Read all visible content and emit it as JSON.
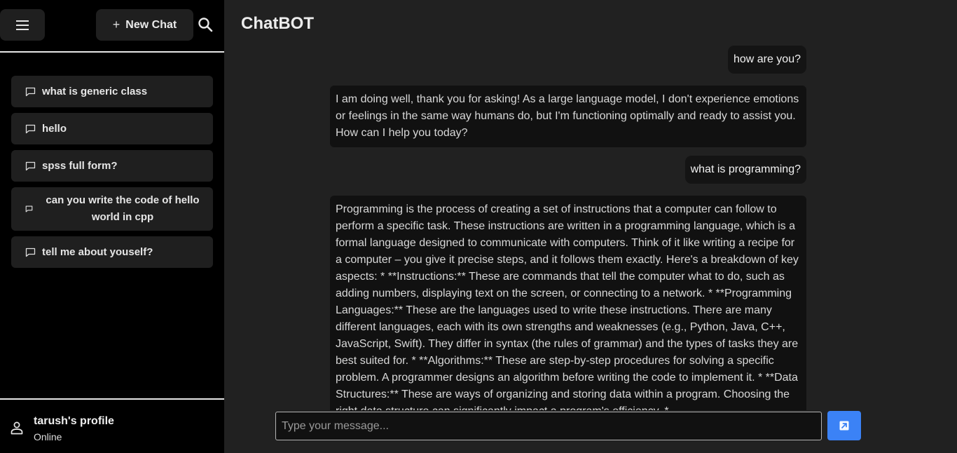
{
  "sidebar": {
    "new_chat_label": "New Chat",
    "history": [
      {
        "label": "what is generic class"
      },
      {
        "label": "hello"
      },
      {
        "label": "spss full form?"
      },
      {
        "label": "can you write the code of hello world in cpp"
      },
      {
        "label": "tell me about youself?"
      }
    ],
    "profile": {
      "name": "tarush's profile",
      "status": "Online"
    }
  },
  "main": {
    "title": "ChatBOT",
    "messages": [
      {
        "role": "user",
        "text": "how are you?"
      },
      {
        "role": "bot",
        "text": "I am doing well, thank you for asking! As a large language model, I don't experience emotions or feelings in the same way humans do, but I'm functioning optimally and ready to assist you. How can I help you today?"
      },
      {
        "role": "user",
        "text": "what is programming?"
      },
      {
        "role": "bot",
        "text": "Programming is the process of creating a set of instructions that a computer can follow to perform a specific task. These instructions are written in a programming language, which is a formal language designed to communicate with computers. Think of it like writing a recipe for a computer – you give it precise steps, and it follows them exactly. Here's a breakdown of key aspects: * **Instructions:** These are commands that tell the computer what to do, such as adding numbers, displaying text on the screen, or connecting to a network. * **Programming Languages:** These are the languages used to write these instructions. There are many different languages, each with its own strengths and weaknesses (e.g., Python, Java, C++, JavaScript, Swift). They differ in syntax (the rules of grammar) and the types of tasks they are best suited for. * **Algorithms:** These are step-by-step procedures for solving a specific problem. A programmer designs an algorithm before writing the code to implement it. * **Data Structures:** These are ways of organizing and storing data within a program. Choosing the right data structure can significantly impact a program's efficiency. *"
      }
    ],
    "input": {
      "placeholder": "Type your message...",
      "value": ""
    }
  },
  "icons": {
    "menu": "hamburger-menu-icon",
    "new_chat": "plus-icon",
    "search": "search-icon",
    "history": "chat-bubble-icon",
    "profile": "user-icon",
    "send": "send-arrow-icon"
  },
  "colors": {
    "sidebar_bg": "#000000",
    "main_bg": "#212121",
    "send_button": "#3b82f6"
  }
}
